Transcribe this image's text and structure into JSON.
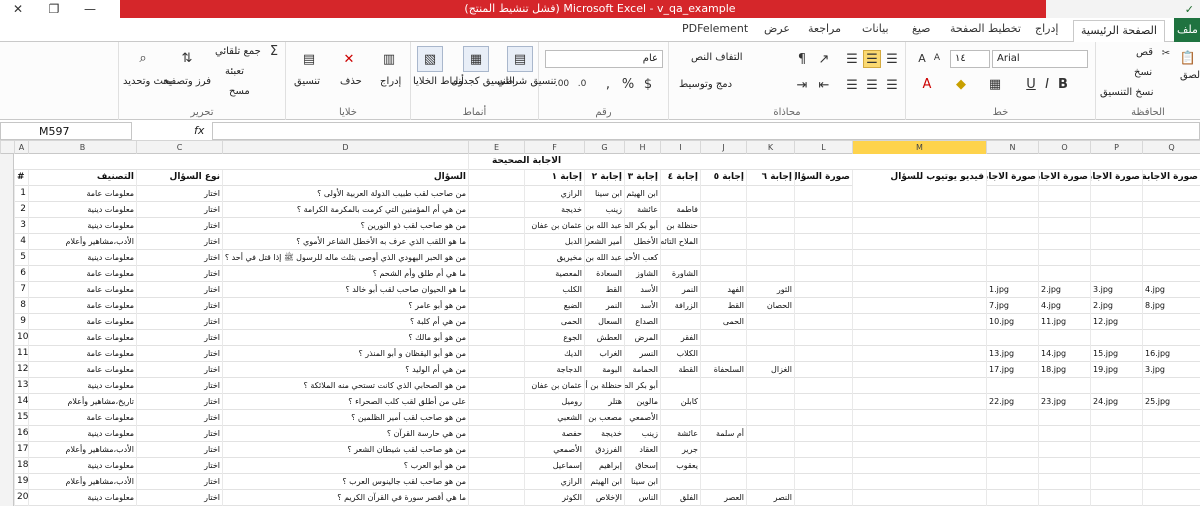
{
  "window": {
    "title": "Microsoft Excel  -  v_qa_example",
    "status": "(فشل تنشيط المنتج)",
    "controls": [
      "✕",
      "❐",
      "—"
    ],
    "qa_mark": "✓"
  },
  "tabs": {
    "file": "ملف",
    "home": "الصفحة الرئيسية",
    "insert": "إدراج",
    "layout": "تخطيط الصفحة",
    "formulas": "صيغ",
    "data": "بيانات",
    "review": "مراجعة",
    "view": "عرض",
    "pdf": "PDFelement"
  },
  "ribbon": {
    "clipboard": {
      "label": "الحافظة",
      "cut": "قص",
      "copy": "نسخ",
      "painter": "نسخ التنسيق",
      "paste": "لصق"
    },
    "font": {
      "label": "خط",
      "name": "Arial",
      "size": "١٤"
    },
    "alignment": {
      "label": "محاذاة",
      "wrap": "التفاف النص",
      "merge": "دمج وتوسيط"
    },
    "number": {
      "label": "رقم",
      "format": "عام"
    },
    "styles": {
      "label": "أنماط",
      "conditional": "تنسيق شرطي",
      "as_table": "التنسيق كجدول",
      "cell_styles": "أنماط الخلايا"
    },
    "cells": {
      "label": "خلايا",
      "insert": "إدراج",
      "delete": "حذف",
      "format": "تنسيق"
    },
    "editing": {
      "label": "تحرير",
      "autosum": "جمع تلقائي",
      "fill": "تعبئة",
      "clear": "مسح",
      "sort": "فرز وتصفية",
      "find": "بحث وتحديد"
    }
  },
  "formula_bar": {
    "name_box": "M597",
    "fx": "fx",
    "value": ""
  },
  "columns": [
    "A",
    "B",
    "C",
    "D",
    "E",
    "F",
    "G",
    "H",
    "I",
    "J",
    "K",
    "L",
    "M",
    "N",
    "O",
    "P",
    "Q"
  ],
  "header_row": {
    "A": "#",
    "B": "التصنيف",
    "C": "نوع السؤال",
    "D": "السؤال",
    "F": "إجابة ١",
    "G": "إجابة ٢",
    "H": "إجابة ٣",
    "I": "إجابة ٤",
    "J": "إجابة ٥",
    "K": "إجابة ٦",
    "L": "صورة السؤال",
    "M": "فيديو يوتيوب للسؤال",
    "N": "صورة الاجابة ١",
    "O": "صورة الاجابة ٢",
    "P": "صورة الاجابة ٣",
    "Q": "صورة الاجابة ٤"
  },
  "merged_title": "الاجابة الصحيحة",
  "rows": [
    {
      "n": "1",
      "B": "معلومات عامة",
      "C": "اختار",
      "D": "من صاحب لقب طبيب الدولة العربية الأولى ؟",
      "F": "الرازي",
      "G": "ابن سينا",
      "H": "ابن الهيثم",
      "I": "",
      "J": "",
      "K": "",
      "N": "",
      "O": "",
      "P": "",
      "Q": ""
    },
    {
      "n": "2",
      "B": "معلومات دينية",
      "C": "اختار",
      "D": "من هي أم المؤمنين التي كرمت بالمكرمة الكرامة ؟",
      "F": "خديجة",
      "G": "زينب",
      "H": "عائشة",
      "I": "فاطمة",
      "J": "",
      "K": "",
      "N": "",
      "O": "",
      "P": "",
      "Q": ""
    },
    {
      "n": "3",
      "B": "معلومات دينية",
      "C": "اختار",
      "D": "من هو صاحب لقب ذو النورين ؟",
      "F": "عثمان بن عفان",
      "G": "عبد الله بن الطفيل الأزدي",
      "H": "أبو بكر الصديق",
      "I": "حنظلة بن",
      "J": "",
      "K": "",
      "N": "",
      "O": "",
      "P": "",
      "Q": ""
    },
    {
      "n": "4",
      "B": "الأدب،مشاهير وأعلام",
      "C": "اختار",
      "D": "ما هو اللقب الذي عرف به الأخطل الشاعر الأموي ؟",
      "F": "الدبل",
      "G": "أمير الشعراء",
      "H": "الأخطل",
      "I": "الملاح التائه",
      "J": "",
      "K": "",
      "N": "",
      "O": "",
      "P": "",
      "Q": ""
    },
    {
      "n": "5",
      "B": "معلومات دينية",
      "C": "اختار",
      "D": "من هو الحبر اليهودي الذي أوصى بثلث ماله للرسول ﷺ إذا قتل في أحد ؟",
      "F": "مخيريق",
      "G": "عبد الله بن سلام",
      "H": "كعب الأحبار",
      "I": "",
      "J": "",
      "K": "",
      "N": "",
      "O": "",
      "P": "",
      "Q": ""
    },
    {
      "n": "6",
      "B": "معلومات عامة",
      "C": "اختار",
      "D": "ما هي أم طلق وأم الشحم ؟",
      "F": "المعصية",
      "G": "السعادة",
      "H": "الشاوز",
      "I": "الشاورة",
      "J": "",
      "K": "",
      "N": "",
      "O": "",
      "P": "",
      "Q": ""
    },
    {
      "n": "7",
      "B": "معلومات عامة",
      "C": "اختار",
      "D": "ما هو الحيوان صاحب لقب أبو خالد ؟",
      "F": "الكلب",
      "G": "القط",
      "H": "الأسد",
      "I": "النمر",
      "J": "الفهد",
      "K": "الثور",
      "N": "1.jpg",
      "O": "2.jpg",
      "P": "3.jpg",
      "Q": "4.jpg"
    },
    {
      "n": "8",
      "B": "معلومات عامة",
      "C": "اختار",
      "D": "من هو أبو عامر ؟",
      "F": "الضبع",
      "G": "النمر",
      "H": "الأسد",
      "I": "الزرافة",
      "J": "القط",
      "K": "الحصان",
      "N": "7.jpg",
      "O": "4.jpg",
      "P": "2.jpg",
      "Q": "8.jpg"
    },
    {
      "n": "9",
      "B": "معلومات عامة",
      "C": "اختار",
      "D": "من هي أم كلبة ؟",
      "F": "الحمى",
      "G": "السعال",
      "H": "الصداع",
      "I": "",
      "J": "الحمى",
      "K": "",
      "N": "10.jpg",
      "O": "11.jpg",
      "P": "12.jpg",
      "Q": ""
    },
    {
      "n": "10",
      "B": "معلومات عامة",
      "C": "اختار",
      "D": "من هو أبو مالك ؟",
      "F": "الجوع",
      "G": "العطش",
      "H": "المرض",
      "I": "الفقر",
      "J": "",
      "K": "",
      "N": "",
      "O": "",
      "P": "",
      "Q": ""
    },
    {
      "n": "11",
      "B": "معلومات عامة",
      "C": "اختار",
      "D": "من هو أبو اليقظان و أبو المنذر ؟",
      "F": "الديك",
      "G": "الغراب",
      "H": "النسر",
      "I": "الكلاب",
      "J": "",
      "K": "",
      "N": "13.jpg",
      "O": "14.jpg",
      "P": "15.jpg",
      "Q": "16.jpg"
    },
    {
      "n": "12",
      "B": "معلومات عامة",
      "C": "اختار",
      "D": "من هي أم الوليد ؟",
      "F": "الدجاجة",
      "G": "البومة",
      "H": "الحمامة",
      "I": "القطة",
      "J": "السلحفاة",
      "K": "الغزال",
      "N": "17.jpg",
      "O": "18.jpg",
      "P": "19.jpg",
      "Q": "3.jpg"
    },
    {
      "n": "13",
      "B": "معلومات دينية",
      "C": "اختار",
      "D": "من هو الصحابي الذي كانت تستحي منه الملائكة ؟",
      "F": "عثمان بن عفان",
      "G": "حنظلة بن أبي عامر",
      "H": "أبو بكر الصديق",
      "I": "",
      "J": "",
      "K": "",
      "N": "",
      "O": "",
      "P": "",
      "Q": ""
    },
    {
      "n": "14",
      "B": "تاريخ،مشاهير وأعلام",
      "C": "اختار",
      "D": "على من أطلق لقب كلب الصحراء ؟",
      "F": "روميل",
      "G": "هتلر",
      "H": "مالوين",
      "I": "كابلن",
      "J": "",
      "K": "",
      "N": "22.jpg",
      "O": "23.jpg",
      "P": "24.jpg",
      "Q": "25.jpg"
    },
    {
      "n": "15",
      "B": "معلومات عامة",
      "C": "اختار",
      "D": "من هو صاحب لقب أمير الظلمين ؟",
      "F": "الشعبي",
      "G": "مصعب بن الزبير",
      "H": "الأصمعي",
      "I": "",
      "J": "",
      "K": "",
      "N": "",
      "O": "",
      "P": "",
      "Q": ""
    },
    {
      "n": "16",
      "B": "معلومات دينية",
      "C": "اختار",
      "D": "من هي حارسة القرآن ؟",
      "F": "حفصة",
      "G": "خديجة",
      "H": "زينب",
      "I": "عائشة",
      "J": "أم سلمة",
      "K": "",
      "N": "",
      "O": "",
      "P": "",
      "Q": ""
    },
    {
      "n": "17",
      "B": "الأدب،مشاهير وأعلام",
      "C": "اختار",
      "D": "من هو صاحب لقب شيطان الشعر ؟",
      "F": "الأصمعي",
      "G": "الفرزدق",
      "H": "العقاد",
      "I": "جرير",
      "J": "",
      "K": "",
      "N": "",
      "O": "",
      "P": "",
      "Q": ""
    },
    {
      "n": "18",
      "B": "معلومات دينية",
      "C": "اختار",
      "D": "من هو أبو العرب ؟",
      "F": "إسماعيل",
      "G": "إبراهيم",
      "H": "إسحاق",
      "I": "يعقوب",
      "J": "",
      "K": "",
      "N": "",
      "O": "",
      "P": "",
      "Q": ""
    },
    {
      "n": "19",
      "B": "الأدب،مشاهير وأعلام",
      "C": "اختار",
      "D": "من هو صاحب لقب جالينوس العرب ؟",
      "F": "الرازي",
      "G": "ابن الهيثم",
      "H": "ابن سينا",
      "I": "",
      "J": "",
      "K": "",
      "N": "",
      "O": "",
      "P": "",
      "Q": ""
    },
    {
      "n": "20",
      "B": "معلومات دينية",
      "C": "اختار",
      "D": "ما هي أقصر سورة في القرآن الكريم ؟",
      "F": "الكوثر",
      "G": "الإخلاص",
      "H": "الناس",
      "I": "الفلق",
      "J": "العصر",
      "K": "النصر",
      "N": "",
      "O": "",
      "P": "",
      "Q": ""
    }
  ]
}
